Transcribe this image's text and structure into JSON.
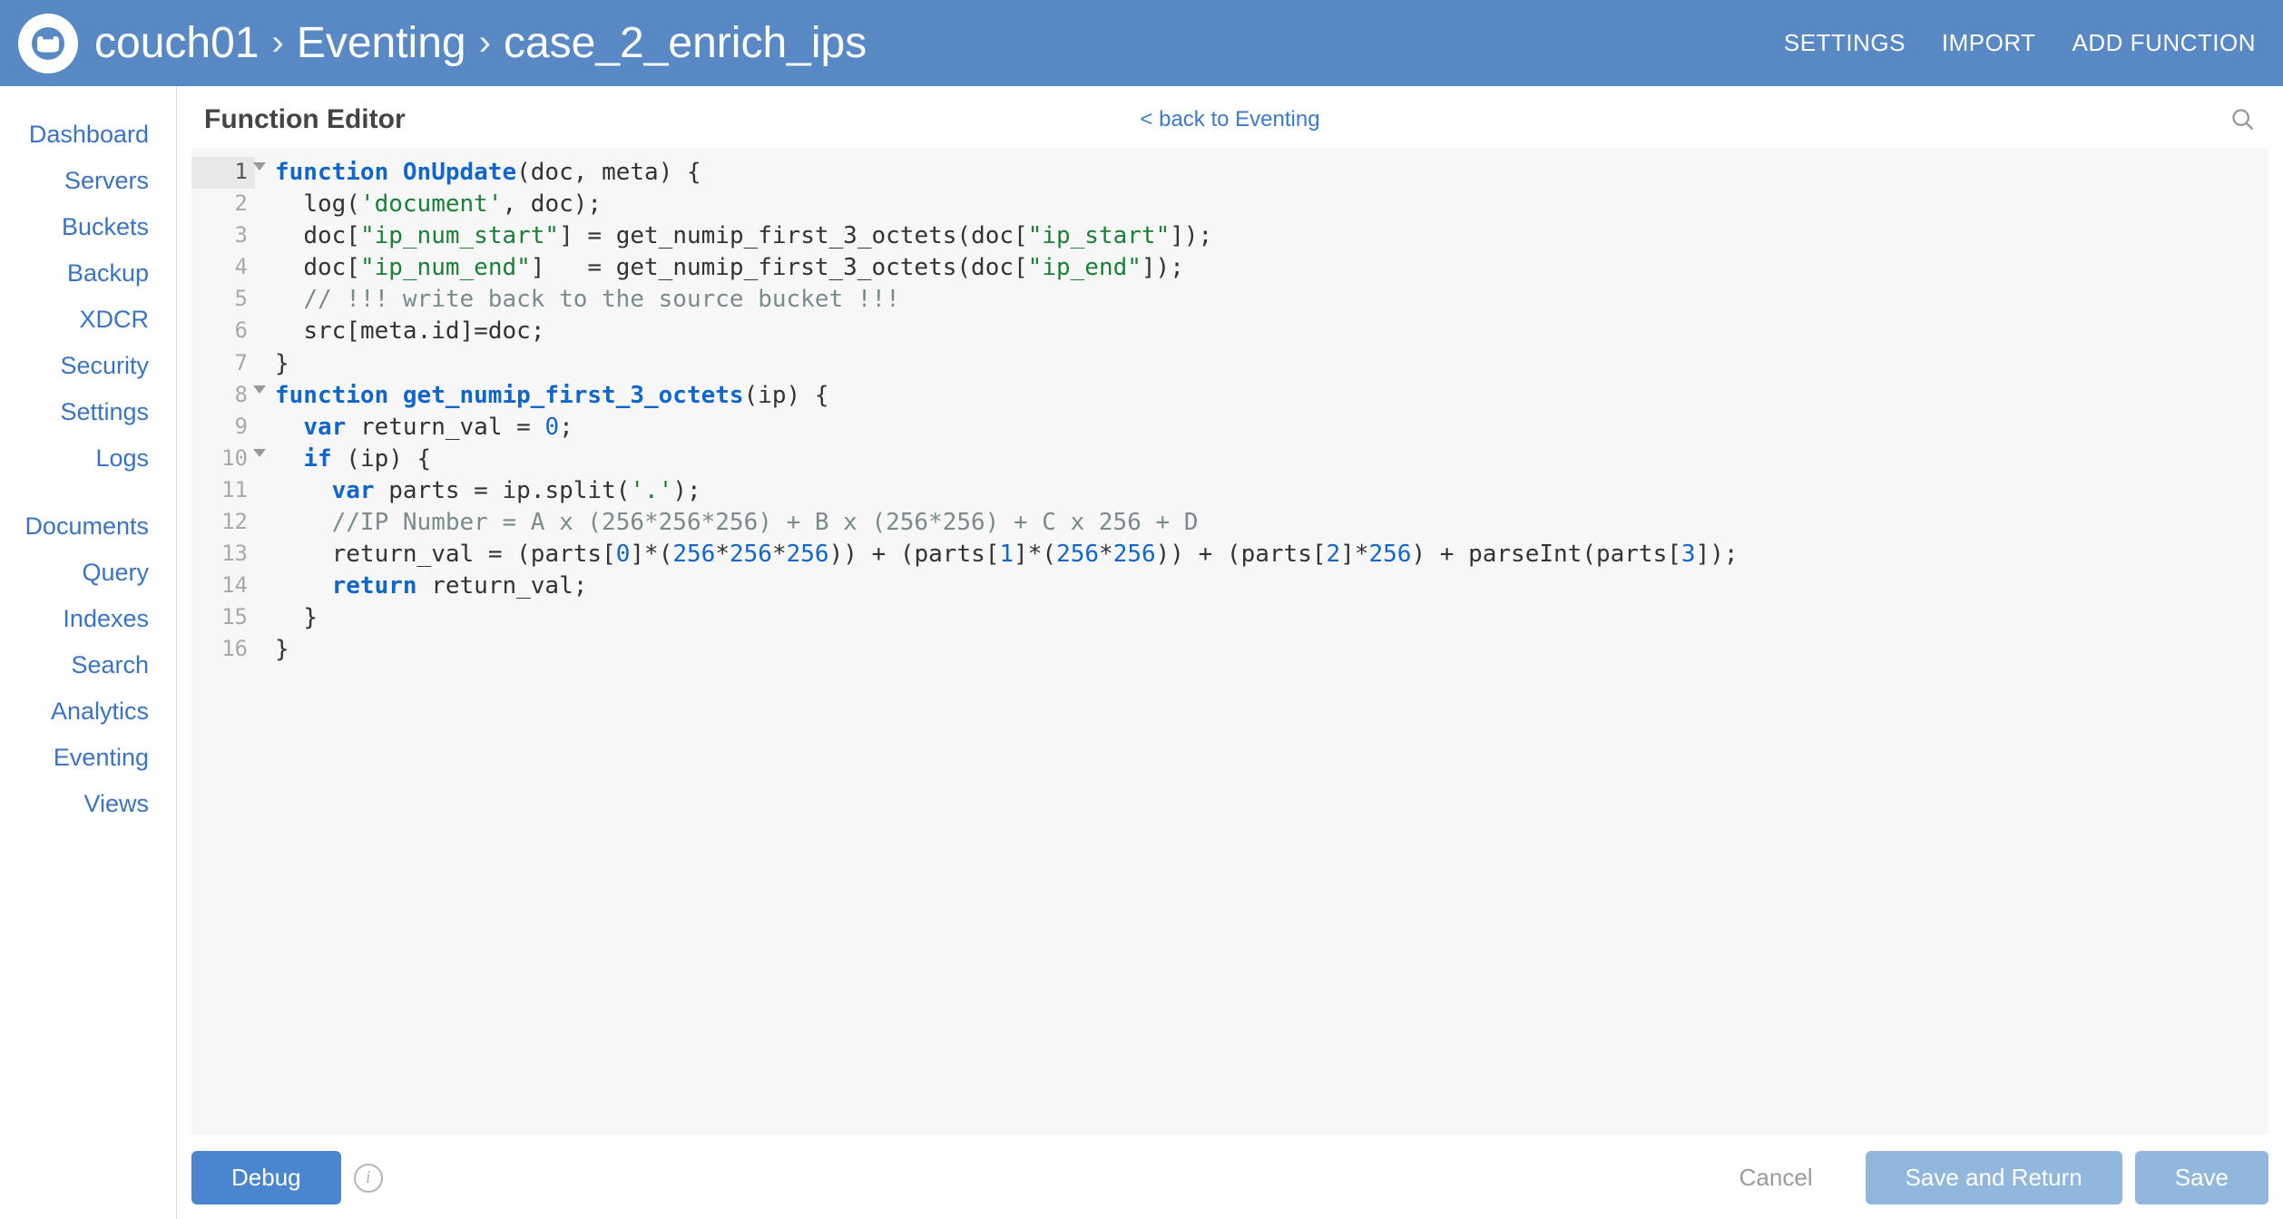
{
  "header": {
    "breadcrumbs": [
      "couch01",
      "Eventing",
      "case_2_enrich_ips"
    ],
    "actions": {
      "settings": "SETTINGS",
      "import": "IMPORT",
      "add_function": "ADD FUNCTION"
    }
  },
  "sidebar": {
    "group1": [
      "Dashboard",
      "Servers",
      "Buckets",
      "Backup",
      "XDCR",
      "Security",
      "Settings",
      "Logs"
    ],
    "group2": [
      "Documents",
      "Query",
      "Indexes",
      "Search",
      "Analytics",
      "Eventing",
      "Views"
    ]
  },
  "page": {
    "title": "Function Editor",
    "back_link": "< back to Eventing"
  },
  "editor": {
    "lines": [
      {
        "n": 1,
        "fold": true,
        "tokens": [
          [
            "kw",
            "function"
          ],
          [
            "sp",
            " "
          ],
          [
            "fn",
            "OnUpdate"
          ],
          [
            "p",
            "("
          ],
          [
            "id",
            "doc"
          ],
          [
            "p",
            ", "
          ],
          [
            "id",
            "meta"
          ],
          [
            "p",
            ") {"
          ]
        ]
      },
      {
        "n": 2,
        "tokens": [
          [
            "sp",
            "  "
          ],
          [
            "id",
            "log"
          ],
          [
            "p",
            "("
          ],
          [
            "str",
            "'document'"
          ],
          [
            "p",
            ", "
          ],
          [
            "id",
            "doc"
          ],
          [
            "p",
            ");"
          ]
        ]
      },
      {
        "n": 3,
        "tokens": [
          [
            "sp",
            "  "
          ],
          [
            "id",
            "doc"
          ],
          [
            "p",
            "["
          ],
          [
            "str",
            "\"ip_num_start\""
          ],
          [
            "p",
            "] = "
          ],
          [
            "id",
            "get_numip_first_3_octets"
          ],
          [
            "p",
            "("
          ],
          [
            "id",
            "doc"
          ],
          [
            "p",
            "["
          ],
          [
            "str",
            "\"ip_start\""
          ],
          [
            "p",
            "]);"
          ]
        ]
      },
      {
        "n": 4,
        "tokens": [
          [
            "sp",
            "  "
          ],
          [
            "id",
            "doc"
          ],
          [
            "p",
            "["
          ],
          [
            "str",
            "\"ip_num_end\""
          ],
          [
            "p",
            "]   = "
          ],
          [
            "id",
            "get_numip_first_3_octets"
          ],
          [
            "p",
            "("
          ],
          [
            "id",
            "doc"
          ],
          [
            "p",
            "["
          ],
          [
            "str",
            "\"ip_end\""
          ],
          [
            "p",
            "]);"
          ]
        ]
      },
      {
        "n": 5,
        "tokens": [
          [
            "sp",
            "  "
          ],
          [
            "com",
            "// !!! write back to the source bucket !!!"
          ]
        ]
      },
      {
        "n": 6,
        "tokens": [
          [
            "sp",
            "  "
          ],
          [
            "id",
            "src"
          ],
          [
            "p",
            "["
          ],
          [
            "id",
            "meta"
          ],
          [
            "p",
            "."
          ],
          [
            "id",
            "id"
          ],
          [
            "p",
            "]="
          ],
          [
            "id",
            "doc"
          ],
          [
            "p",
            ";"
          ]
        ]
      },
      {
        "n": 7,
        "tokens": [
          [
            "p",
            "}"
          ]
        ]
      },
      {
        "n": 8,
        "fold": true,
        "tokens": [
          [
            "kw",
            "function"
          ],
          [
            "sp",
            " "
          ],
          [
            "fn",
            "get_numip_first_3_octets"
          ],
          [
            "p",
            "("
          ],
          [
            "id",
            "ip"
          ],
          [
            "p",
            ") {"
          ]
        ]
      },
      {
        "n": 9,
        "tokens": [
          [
            "sp",
            "  "
          ],
          [
            "kw",
            "var"
          ],
          [
            "sp",
            " "
          ],
          [
            "id",
            "return_val"
          ],
          [
            "p",
            " = "
          ],
          [
            "num",
            "0"
          ],
          [
            "p",
            ";"
          ]
        ]
      },
      {
        "n": 10,
        "fold": true,
        "tokens": [
          [
            "sp",
            "  "
          ],
          [
            "kw",
            "if"
          ],
          [
            "p",
            " ("
          ],
          [
            "id",
            "ip"
          ],
          [
            "p",
            ") {"
          ]
        ]
      },
      {
        "n": 11,
        "tokens": [
          [
            "sp",
            "    "
          ],
          [
            "kw",
            "var"
          ],
          [
            "sp",
            " "
          ],
          [
            "id",
            "parts"
          ],
          [
            "p",
            " = "
          ],
          [
            "id",
            "ip"
          ],
          [
            "p",
            "."
          ],
          [
            "id",
            "split"
          ],
          [
            "p",
            "("
          ],
          [
            "str",
            "'.'"
          ],
          [
            "p",
            ");"
          ]
        ]
      },
      {
        "n": 12,
        "tokens": [
          [
            "sp",
            "    "
          ],
          [
            "com",
            "//IP Number = A x (256*256*256) + B x (256*256) + C x 256 + D"
          ]
        ]
      },
      {
        "n": 13,
        "tokens": [
          [
            "sp",
            "    "
          ],
          [
            "id",
            "return_val"
          ],
          [
            "p",
            " = ("
          ],
          [
            "id",
            "parts"
          ],
          [
            "p",
            "["
          ],
          [
            "num",
            "0"
          ],
          [
            "p",
            "]*("
          ],
          [
            "num",
            "256"
          ],
          [
            "p",
            "*"
          ],
          [
            "num",
            "256"
          ],
          [
            "p",
            "*"
          ],
          [
            "num",
            "256"
          ],
          [
            "p",
            ")) + ("
          ],
          [
            "id",
            "parts"
          ],
          [
            "p",
            "["
          ],
          [
            "num",
            "1"
          ],
          [
            "p",
            "]*("
          ],
          [
            "num",
            "256"
          ],
          [
            "p",
            "*"
          ],
          [
            "num",
            "256"
          ],
          [
            "p",
            ")) + ("
          ],
          [
            "id",
            "parts"
          ],
          [
            "p",
            "["
          ],
          [
            "num",
            "2"
          ],
          [
            "p",
            "]*"
          ],
          [
            "num",
            "256"
          ],
          [
            "p",
            ") + "
          ],
          [
            "id",
            "parseInt"
          ],
          [
            "p",
            "("
          ],
          [
            "id",
            "parts"
          ],
          [
            "p",
            "["
          ],
          [
            "num",
            "3"
          ],
          [
            "p",
            "]);"
          ]
        ]
      },
      {
        "n": 14,
        "tokens": [
          [
            "sp",
            "    "
          ],
          [
            "kw",
            "return"
          ],
          [
            "sp",
            " "
          ],
          [
            "id",
            "return_val"
          ],
          [
            "p",
            ";"
          ]
        ]
      },
      {
        "n": 15,
        "tokens": [
          [
            "sp",
            "  "
          ],
          [
            "p",
            "}"
          ]
        ]
      },
      {
        "n": 16,
        "tokens": [
          [
            "p",
            "}"
          ]
        ]
      }
    ]
  },
  "footer": {
    "debug": "Debug",
    "cancel": "Cancel",
    "save_return": "Save and Return",
    "save": "Save"
  }
}
